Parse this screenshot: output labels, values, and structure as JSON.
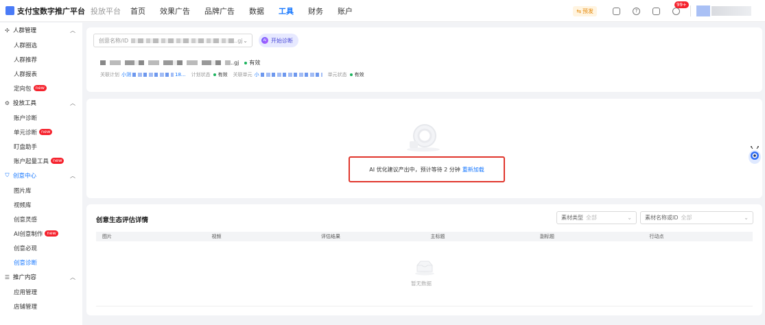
{
  "header": {
    "brand": "支付宝数字推广平台",
    "subtitle": "投放平台",
    "nav": [
      "首页",
      "效果广告",
      "品牌广告",
      "数据",
      "工具",
      "财务",
      "账户"
    ],
    "active_nav": "工具",
    "warn_label": "预发",
    "badge_count": "99+"
  },
  "sidebar": {
    "groups": [
      {
        "title": "人群管理",
        "items": [
          {
            "label": "人群圈选"
          },
          {
            "label": "人群推荐"
          },
          {
            "label": "人群报表"
          },
          {
            "label": "定向包",
            "tag": "new"
          }
        ]
      },
      {
        "title": "投放工具",
        "items": [
          {
            "label": "账户诊断"
          },
          {
            "label": "单元诊断",
            "tag": "new"
          },
          {
            "label": "盯盘助手"
          },
          {
            "label": "账户起量工具",
            "tag": "new"
          }
        ]
      },
      {
        "title": "创意中心",
        "items": [
          {
            "label": "图片库"
          },
          {
            "label": "视频库"
          },
          {
            "label": "创意灵感"
          },
          {
            "label": "AI创意制作",
            "tag": "new"
          },
          {
            "label": "创意必现"
          },
          {
            "label": "创意诊断"
          }
        ]
      },
      {
        "title": "推广内容",
        "items": [
          {
            "label": "应用管理"
          },
          {
            "label": "店铺管理"
          }
        ]
      }
    ]
  },
  "search": {
    "placeholder": "创意名称/ID",
    "blurred_tail": "..gj",
    "diag_button": "开始诊断",
    "ai_mark": "AI"
  },
  "creative": {
    "name_tail": "..gj",
    "status": "有效",
    "plan_label": "关联计划",
    "plan_prefix": "小测",
    "plan_mid": "18...",
    "plan_status_label": "计划状态",
    "plan_status": "有效",
    "unit_label": "关联单元",
    "unit_prefix": "小",
    "unit_status_label": "单元状态",
    "unit_status": "有效"
  },
  "loading": {
    "message": "AI 优化建议产出中，预计等待 2 分钟",
    "reload": "重新加载"
  },
  "ecology": {
    "title": "创意生态评估详情",
    "filter1_label": "素材类型",
    "filter1_value": "全部",
    "filter2_label": "素材名称或ID",
    "filter2_value": "全部",
    "columns": [
      "图片",
      "视频",
      "评估结果",
      "主标题",
      "副标题",
      "行动点"
    ],
    "empty_text": "暂无数据"
  }
}
